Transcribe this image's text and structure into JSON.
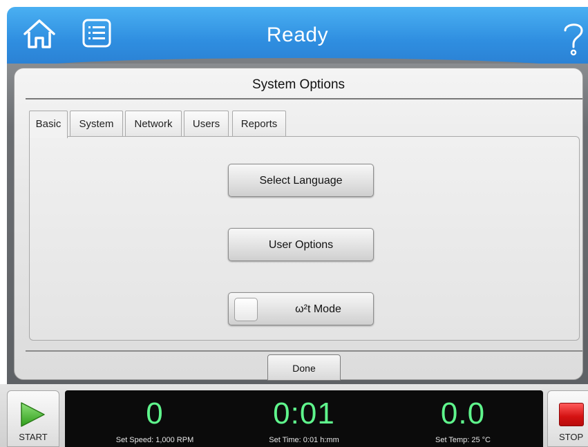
{
  "header": {
    "status": "Ready",
    "home_icon": "home-icon",
    "menu_icon": "list-menu-icon",
    "help_icon": "help-question-icon",
    "accent_color": "#2f8ee0"
  },
  "panel": {
    "title": "System Options",
    "tabs": [
      {
        "label": "Basic",
        "active": true
      },
      {
        "label": "System",
        "active": false
      },
      {
        "label": "Network",
        "active": false
      },
      {
        "label": "Users",
        "active": false
      },
      {
        "label": "Reports",
        "active": false
      }
    ],
    "buttons": {
      "select_language": "Select Language",
      "user_options": "User Options",
      "omega_mode": "ω²t Mode"
    },
    "omega_mode_checked": false,
    "done": "Done"
  },
  "footer": {
    "start_label": "START",
    "stop_label": "STOP",
    "speed": {
      "value": "0",
      "caption": "Set Speed: 1,000 RPM"
    },
    "time": {
      "value": "0:01",
      "caption": "Set Time: 0:01 h:mm"
    },
    "temp": {
      "value": "0.0",
      "caption": "Set Temp: 25 °C"
    },
    "readout_color": "#5ff58c",
    "stop_color": "#d41212",
    "start_color": "#3cb521"
  }
}
